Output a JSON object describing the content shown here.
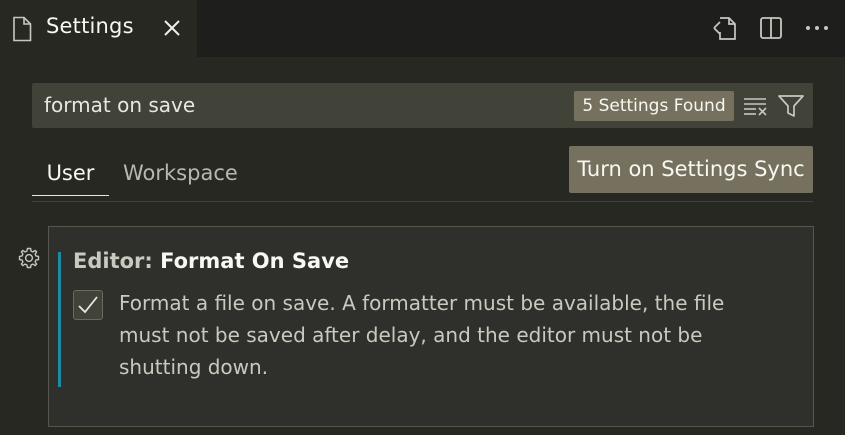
{
  "editor_tab": {
    "label": "Settings",
    "file_icon": "file-icon",
    "close_icon": "close-icon"
  },
  "tab_actions": [
    {
      "icon": "open-settings-json-icon"
    },
    {
      "icon": "split-editor-icon"
    },
    {
      "icon": "more-actions-icon"
    }
  ],
  "search": {
    "value": "format on save",
    "result_count": "5 Settings Found",
    "clear_icon": "clear-filter-icon",
    "filter_icon": "filter-icon"
  },
  "scope_tabs": {
    "user": "User",
    "workspace": "Workspace",
    "active": "User"
  },
  "sync_button": "Turn on Settings Sync",
  "setting": {
    "category": "Editor: ",
    "name": "Format On Save",
    "checked": true,
    "description": "Format a file on save. A formatter must be available, the file must not be saved after delay, and the editor must not be shutting down.",
    "gear_icon": "gear-icon"
  },
  "colors": {
    "background": "#272822",
    "tabbar": "#1e1f1c",
    "input": "#414339",
    "badge": "#75715e",
    "focus_accent": "#1b8aa4"
  }
}
